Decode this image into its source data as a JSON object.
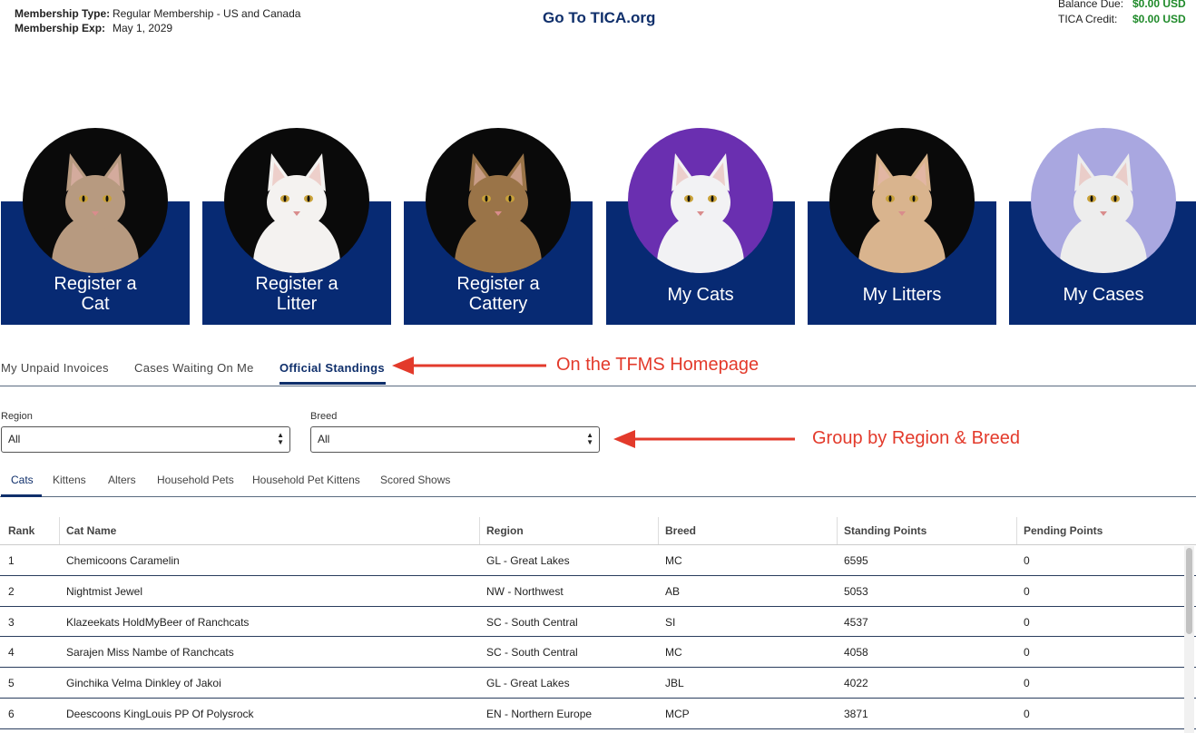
{
  "header": {
    "membership_type_label": "Membership Type:",
    "membership_type_value": "Regular Membership - US and Canada",
    "membership_exp_label": "Membership Exp:",
    "membership_exp_value": "May 1, 2029",
    "goto_link": "Go To TICA.org",
    "balance_due_label": "Balance Due:",
    "balance_due_value": "$0.00 USD",
    "tica_credit_label": "TICA Credit:",
    "tica_credit_value": "$0.00 USD"
  },
  "tiles": [
    {
      "line1": "Register a",
      "line2": "Cat",
      "bg": "#0a0a0a",
      "cat": "#b79a80",
      "icon": "cat-photo-icon"
    },
    {
      "line1": "Register a",
      "line2": "Litter",
      "bg": "#0a0a0a",
      "cat": "#f4f2f0",
      "icon": "white-cat-photo-icon"
    },
    {
      "line1": "Register a",
      "line2": "Cattery",
      "bg": "#0a0a0a",
      "cat": "#9a7448",
      "icon": "bengal-cat-photo-icon"
    },
    {
      "line1": "My Cats",
      "line2": "",
      "bg": "#6a2fb0",
      "cat": "#f2f2f4",
      "icon": "oriental-cat-photo-icon"
    },
    {
      "line1": "My Litters",
      "line2": "",
      "bg": "#0a0a0a",
      "cat": "#d9b48e",
      "icon": "fluffy-cat-photo-icon"
    },
    {
      "line1": "My Cases",
      "line2": "",
      "bg": "#a9a7e0",
      "cat": "#ededed",
      "icon": "kitten-photo-icon"
    }
  ],
  "top_tabs": {
    "unpaid": "My Unpaid Invoices",
    "cases": "Cases Waiting On Me",
    "standings": "Official Standings"
  },
  "annotations": {
    "homepage": "On the TFMS Homepage",
    "group": "Group by Region & Breed"
  },
  "filters": {
    "region_label": "Region",
    "region_value": "All",
    "breed_label": "Breed",
    "breed_value": "All"
  },
  "sub_tabs": {
    "cats": "Cats",
    "kittens": "Kittens",
    "alters": "Alters",
    "household_pets": "Household Pets",
    "household_pet_kittens": "Household Pet Kittens",
    "scored_shows": "Scored Shows"
  },
  "table": {
    "headers": [
      "Rank",
      "Cat Name",
      "Region",
      "Breed",
      "Standing Points",
      "Pending Points"
    ],
    "rows": [
      [
        "1",
        "Chemicoons Caramelin",
        "GL - Great Lakes",
        "MC",
        "6595",
        "0"
      ],
      [
        "2",
        "Nightmist Jewel",
        "NW - Northwest",
        "AB",
        "5053",
        "0"
      ],
      [
        "3",
        "Klazeekats HoldMyBeer of Ranchcats",
        "SC - South Central",
        "SI",
        "4537",
        "0"
      ],
      [
        "4",
        "Sarajen Miss Nambe of Ranchcats",
        "SC - South Central",
        "MC",
        "4058",
        "0"
      ],
      [
        "5",
        "Ginchika Velma Dinkley of Jakoi",
        "GL - Great Lakes",
        "JBL",
        "4022",
        "0"
      ],
      [
        "6",
        "Deescoons KingLouis PP Of Polysrock",
        "EN - Northern Europe",
        "MCP",
        "3871",
        "0"
      ]
    ]
  }
}
